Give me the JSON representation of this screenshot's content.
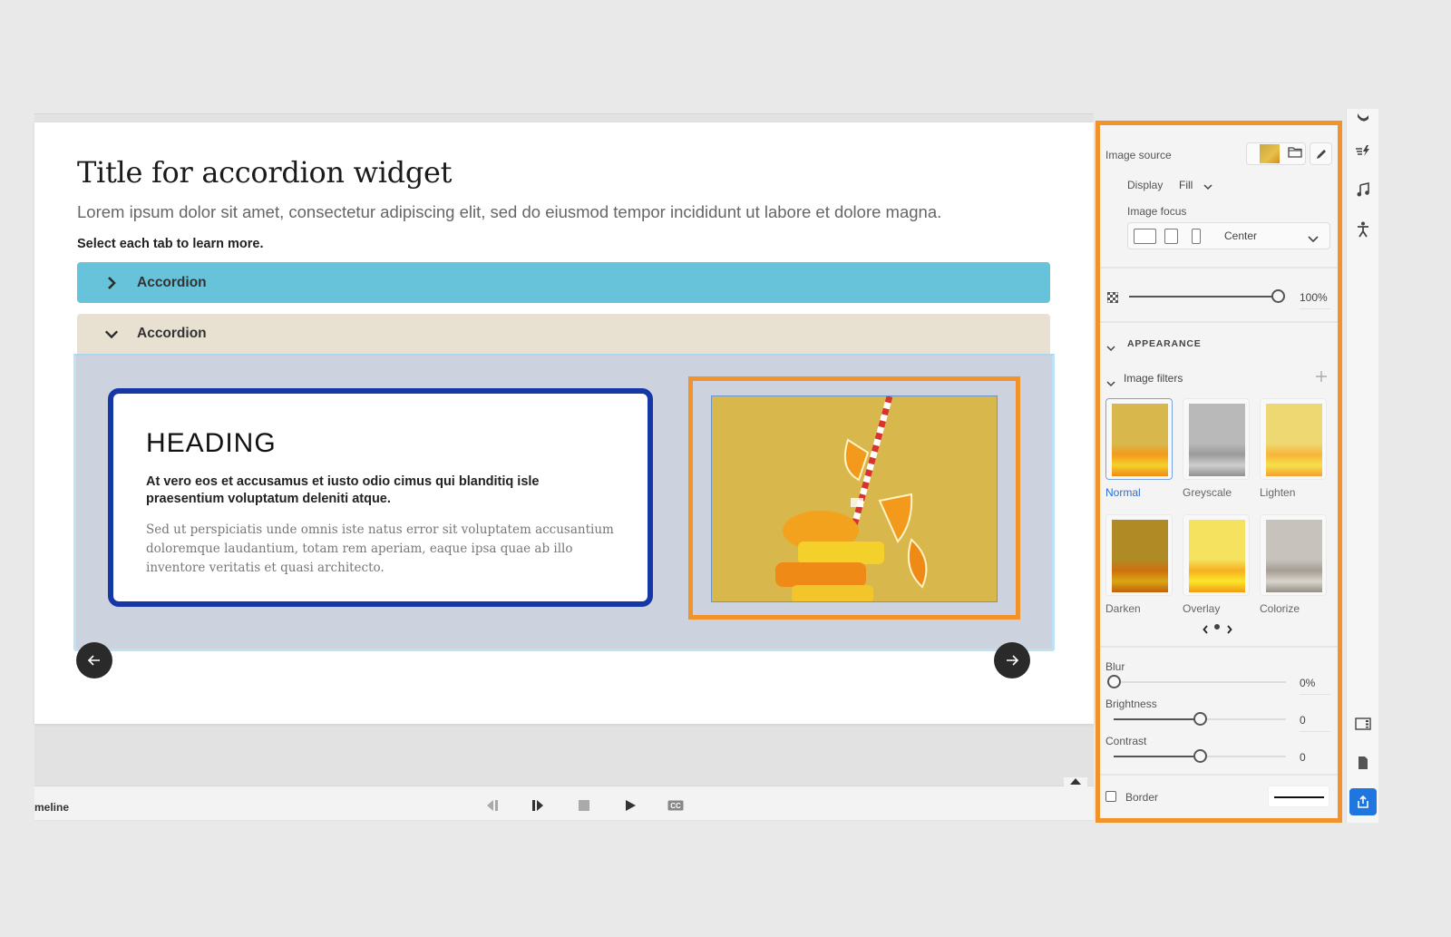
{
  "slide": {
    "title": "Title for accordion widget",
    "lead": "Lorem ipsum dolor sit amet, consectetur adipiscing elit, sed do eiusmod tempor incididunt ut labore et dolore magna.",
    "instruction": "Select each tab to learn more.",
    "accordions": [
      {
        "label": "Accordion",
        "state": "collapsed",
        "color": "#66c3d9"
      },
      {
        "label": "Accordion",
        "state": "expanded",
        "color": "#e8e1d2"
      }
    ],
    "card": {
      "heading": "HEADING",
      "subheading": "At vero eos et accusamus et iusto odio cimus qui blanditiq isle praesentium voluptatum deleniti atque.",
      "body": "Sed ut perspiciatis unde omnis iste natus error sit voluptatem accusantium doloremque laudantium, totam rem aperiam, eaque ipsa quae ab illo inventore veritatis et quasi architecto."
    },
    "image_alt": "orange slices with striped straw",
    "nav": {
      "prev_icon": "arrow-left-icon",
      "next_icon": "arrow-right-icon"
    }
  },
  "timeline": {
    "label": "meline",
    "controls": [
      "step-back-icon",
      "step-forward-icon",
      "stop-icon",
      "play-icon",
      "closed-captions-icon"
    ]
  },
  "properties": {
    "image_source_label": "Image source",
    "display_label": "Display",
    "display_value": "Fill",
    "image_focus_label": "Image focus",
    "image_focus_value": "Center",
    "opacity_value": "100%",
    "opacity_fraction": 1.0,
    "appearance_label": "APPEARANCE",
    "image_filters_label": "Image filters",
    "filters": [
      {
        "label": "Normal",
        "selected": true
      },
      {
        "label": "Greyscale",
        "selected": false
      },
      {
        "label": "Lighten",
        "selected": false
      },
      {
        "label": "Darken",
        "selected": false
      },
      {
        "label": "Overlay",
        "selected": false
      },
      {
        "label": "Colorize",
        "selected": false
      }
    ],
    "blur_label": "Blur",
    "blur_value": "0%",
    "blur_fraction": 0.0,
    "brightness_label": "Brightness",
    "brightness_value": "0",
    "brightness_fraction": 0.5,
    "contrast_label": "Contrast",
    "contrast_value": "0",
    "contrast_fraction": 0.5,
    "border_label": "Border",
    "border_checked": false
  },
  "colors": {
    "highlight": "#f2922b",
    "card_border": "#1638a6",
    "accent_blue": "#1f76e0"
  }
}
